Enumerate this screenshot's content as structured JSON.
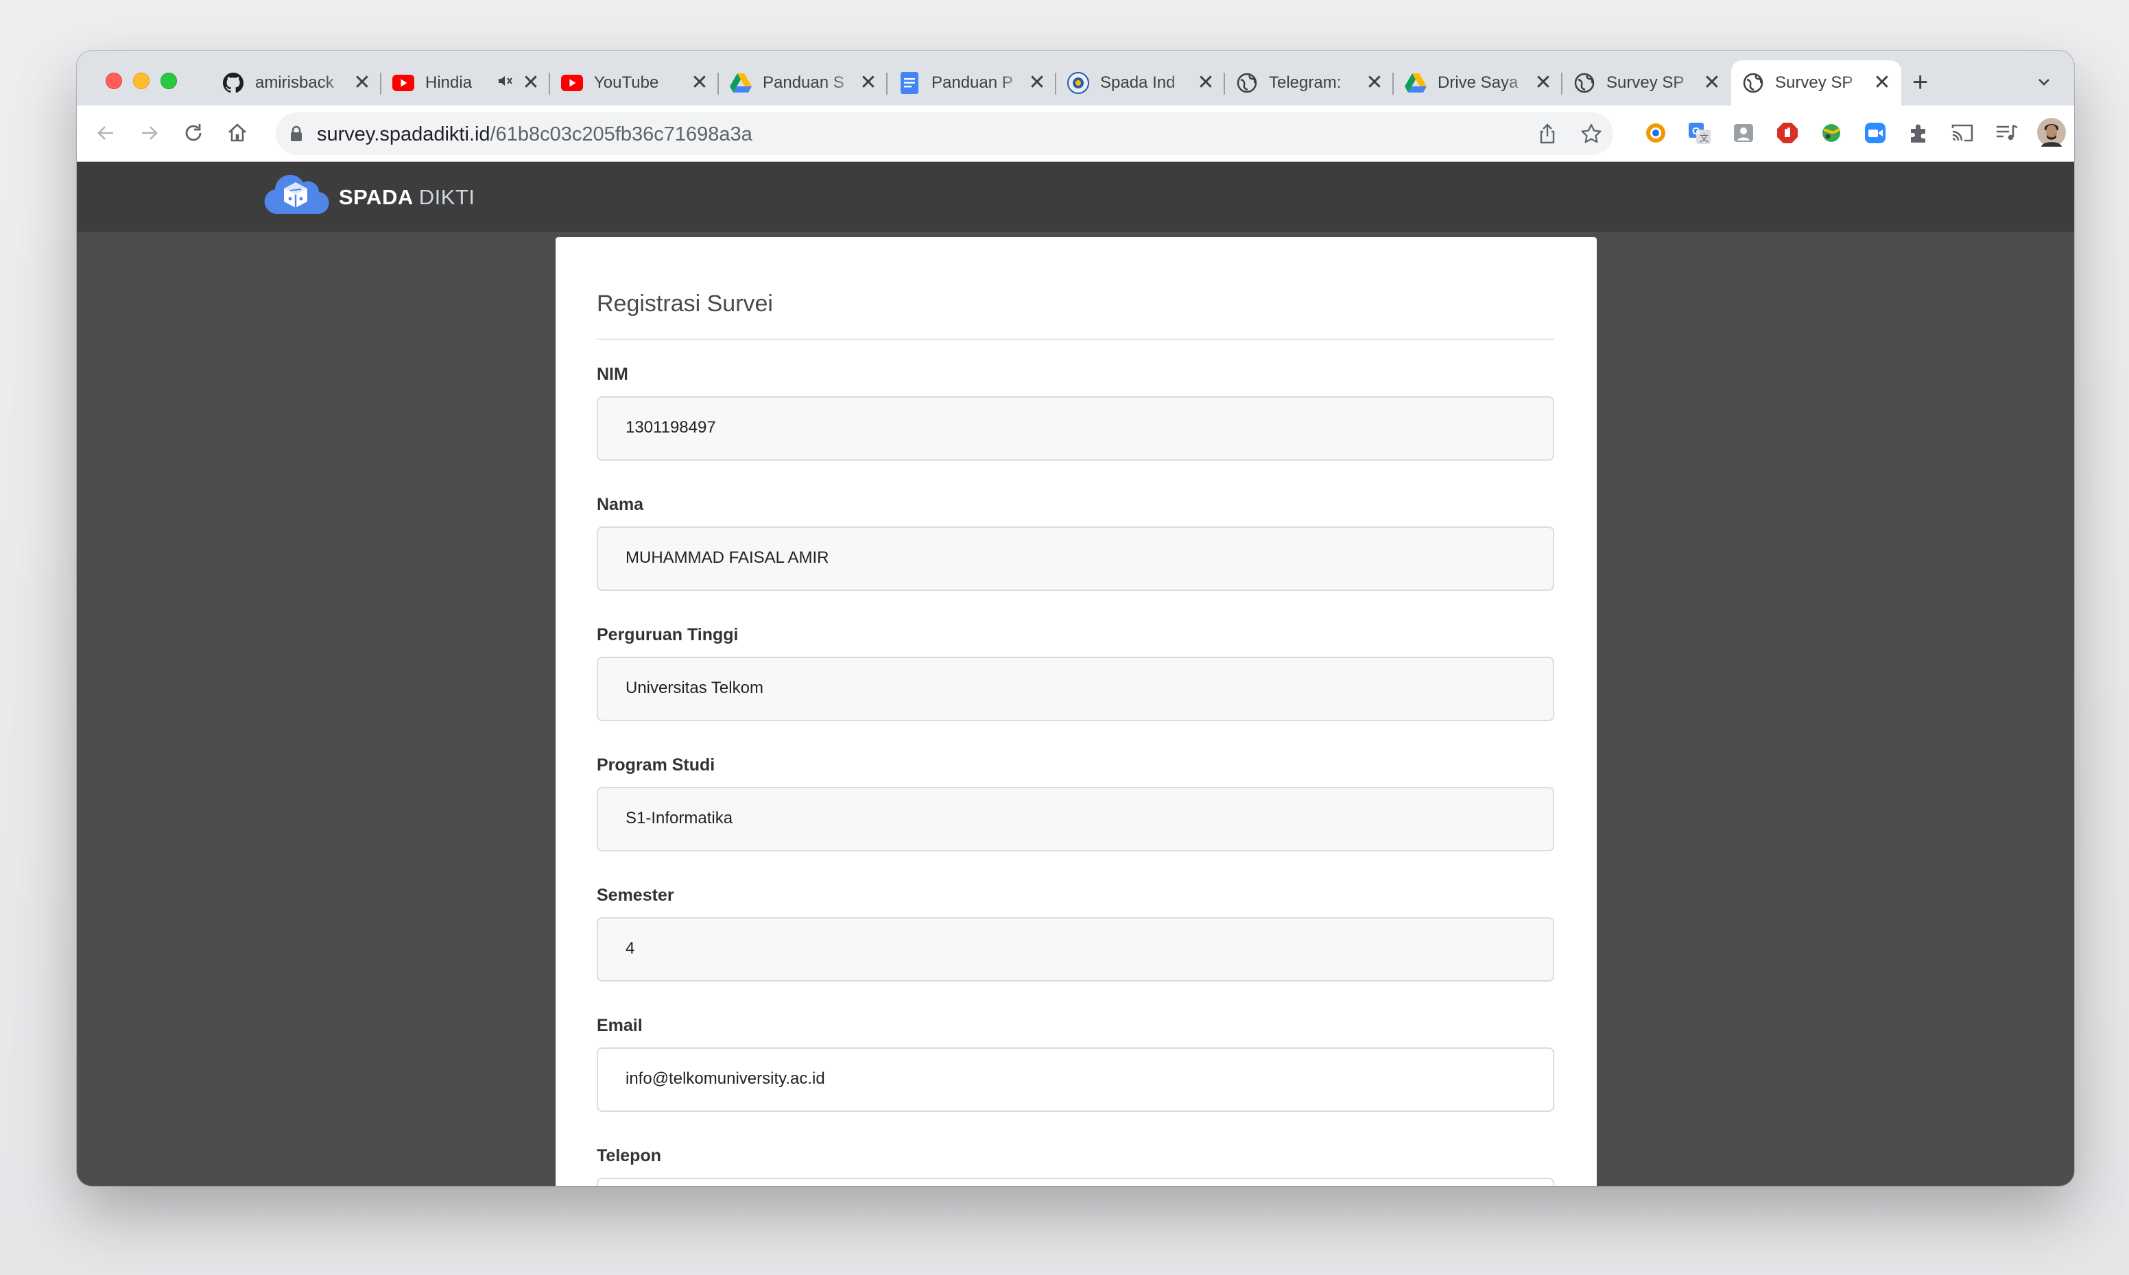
{
  "browser": {
    "tabs": [
      {
        "title": "amirisback",
        "icon": "github-icon"
      },
      {
        "title": "Hindia",
        "icon": "youtube-icon",
        "muted_indicator": "speaker-muted-icon"
      },
      {
        "title": "YouTube",
        "icon": "youtube-icon"
      },
      {
        "title": "Panduan S",
        "icon": "google-drive-icon"
      },
      {
        "title": "Panduan P",
        "icon": "google-docs-icon"
      },
      {
        "title": "Spada Ind",
        "icon": "spada-icon"
      },
      {
        "title": "Telegram:",
        "icon": "globe-icon"
      },
      {
        "title": "Drive Saya",
        "icon": "google-drive-icon"
      },
      {
        "title": "Survey SP",
        "icon": "globe-icon"
      },
      {
        "title": "Survey SP",
        "icon": "globe-icon",
        "active": true
      }
    ],
    "close_glyph": "✕",
    "new_tab_glyph": "+",
    "url_host": "survey.spadadikti.id",
    "url_path": "/61b8c03c205fb36c71698a3a"
  },
  "site": {
    "brand_bold": "SPADA",
    "brand_light": "DIKTI",
    "brand_color": "#4f86e8"
  },
  "form": {
    "title": "Registrasi Survei",
    "fields": [
      {
        "label": "NIM",
        "value": "1301198497"
      },
      {
        "label": "Nama",
        "value": "MUHAMMAD FAISAL AMIR"
      },
      {
        "label": "Perguruan Tinggi",
        "value": "Universitas Telkom"
      },
      {
        "label": "Program Studi",
        "value": "S1-Informatika"
      },
      {
        "label": "Semester",
        "value": "4"
      },
      {
        "label": "Email",
        "value": "info@telkomuniversity.ac.id"
      },
      {
        "label": "Telepon",
        "value": ""
      }
    ]
  }
}
